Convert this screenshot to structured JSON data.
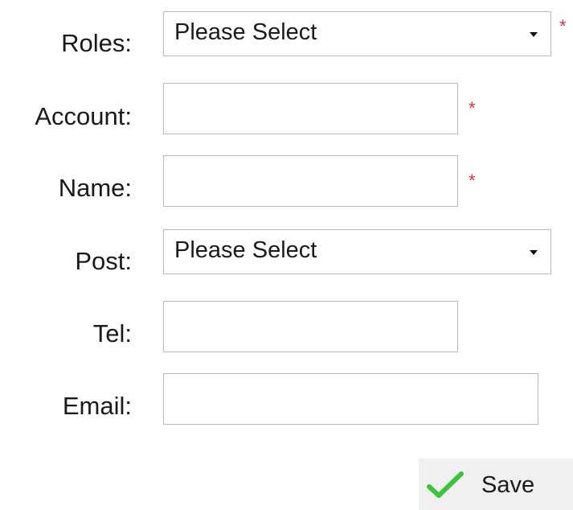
{
  "form": {
    "roles": {
      "label": "Roles:",
      "selected": "Please Select",
      "required_mark": "*"
    },
    "account": {
      "label": "Account:",
      "value": "",
      "required_mark": "*"
    },
    "name": {
      "label": "Name:",
      "value": "",
      "required_mark": "*"
    },
    "post": {
      "label": "Post:",
      "selected": "Please Select"
    },
    "tel": {
      "label": "Tel:",
      "value": ""
    },
    "email": {
      "label": "Email:",
      "value": ""
    }
  },
  "actions": {
    "save_label": "Save",
    "save_icon": "checkmark-icon"
  },
  "colors": {
    "required": "#e03030",
    "checkmark": "#3bc43b",
    "border": "#b9b9b9",
    "button_bg": "#f0f0f0"
  }
}
